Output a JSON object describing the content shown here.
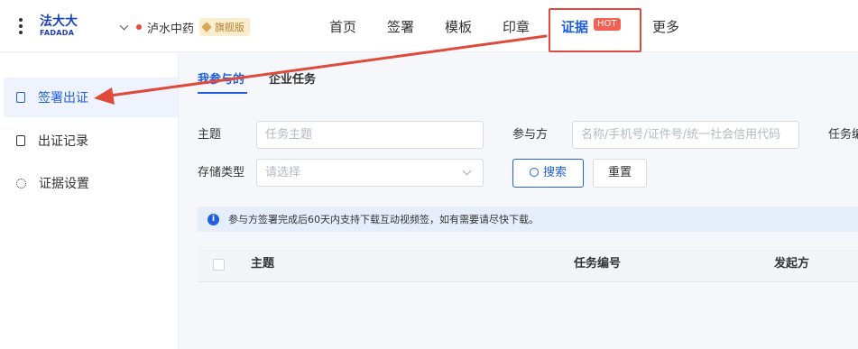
{
  "header": {
    "logo_cn": "法大大",
    "logo_en": "FADADA",
    "org_name": "泸水中药",
    "org_badge": "旗舰版",
    "nav": [
      "首页",
      "签署",
      "模板",
      "印章"
    ],
    "nav_highlight": "证据",
    "nav_highlight_badge": "HOT",
    "nav_more": "更多"
  },
  "sidebar": {
    "items": [
      {
        "label": "签署出证",
        "icon": "doc-icon",
        "active": true
      },
      {
        "label": "出证记录",
        "icon": "record-icon",
        "active": false
      },
      {
        "label": "证据设置",
        "icon": "gear-icon",
        "active": false
      }
    ]
  },
  "tabs": [
    "我参与的",
    "企业任务"
  ],
  "filters": {
    "subject_label": "主题",
    "subject_placeholder": "任务主题",
    "party_label": "参与方",
    "party_placeholder": "名称/手机号/证件号/统一社会信用代码",
    "task_label": "任务编",
    "storage_label": "存储类型",
    "storage_placeholder": "请选择",
    "search_button": "搜索",
    "reset_button": "重置"
  },
  "notice": "参与方签署完成后60天内支持下载互动视频签，如有需要请尽快下载。",
  "table": {
    "columns": [
      "主题",
      "任务编号",
      "发起方"
    ]
  },
  "colors": {
    "primary": "#1f5fe0",
    "annotation_red": "#e04a3c",
    "hot_badge": "#f56154"
  }
}
